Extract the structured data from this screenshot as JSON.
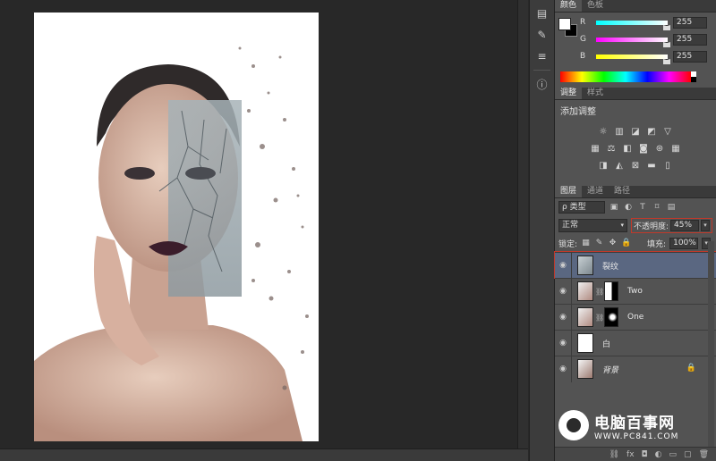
{
  "color_panel": {
    "tabs": [
      "颜色",
      "色板"
    ],
    "channels": [
      {
        "label": "R",
        "value": "255",
        "color": "#00e5e5"
      },
      {
        "label": "G",
        "value": "255",
        "color": "#e53be5"
      },
      {
        "label": "B",
        "value": "255",
        "color": "#e5e500"
      }
    ]
  },
  "adjust_panel": {
    "tabs": [
      "调整",
      "样式"
    ],
    "title": "添加调整"
  },
  "layers_panel": {
    "tabs": [
      "图层",
      "通道",
      "路径"
    ],
    "filter_label": "ρ 类型",
    "blend_mode": "正常",
    "opacity_label": "不透明度:",
    "opacity_value": "45%",
    "lock_label": "锁定:",
    "fill_label": "填充:",
    "fill_value": "100%",
    "layers": [
      {
        "name": "裂纹",
        "selected": true
      },
      {
        "name": "Two"
      },
      {
        "name": "One"
      },
      {
        "name": "白"
      },
      {
        "name": "背景"
      }
    ]
  },
  "watermark": {
    "title": "电脑百事网",
    "url": "WWW.PC841.COM"
  }
}
